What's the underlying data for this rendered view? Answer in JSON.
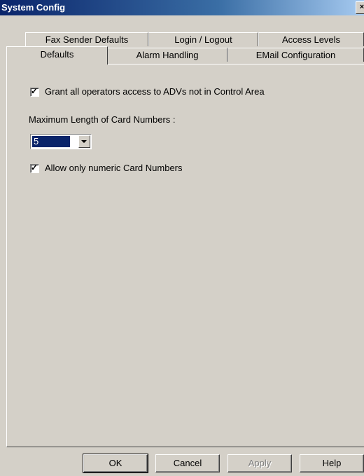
{
  "window": {
    "title": "System Config",
    "close_glyph": "×"
  },
  "tabs": {
    "back_row": [
      {
        "label": "Fax Sender Defaults"
      },
      {
        "label": "Login / Logout"
      },
      {
        "label": "Access Levels"
      }
    ],
    "front_row": [
      {
        "label": "Defaults"
      },
      {
        "label": "Alarm Handling"
      },
      {
        "label": "EMail Configuration"
      }
    ],
    "active": "Defaults"
  },
  "defaults": {
    "grant_access": {
      "label": "Grant all operators access to ADVs not in Control  Area",
      "checked": true
    },
    "max_length_label": "Maximum Length of Card Numbers :",
    "max_length_value": "5",
    "numeric_only": {
      "label": "Allow only numeric Card Numbers",
      "checked": true
    }
  },
  "buttons": {
    "ok": "OK",
    "cancel": "Cancel",
    "apply": "Apply",
    "help": "Help"
  }
}
